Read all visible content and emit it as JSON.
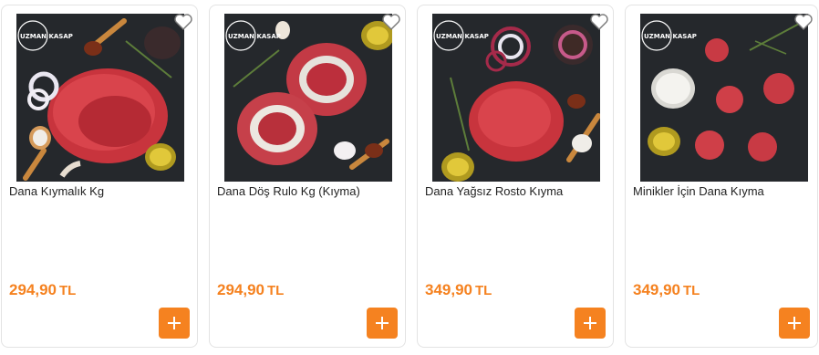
{
  "colors": {
    "accent": "#f58220",
    "image_bg": "#23262a"
  },
  "icons": {
    "favorite": "heart-icon",
    "add": "plus-icon"
  },
  "products": [
    {
      "title": "Dana Kıymalık Kg",
      "price": "294,90",
      "currency": "TL",
      "logo": "UZMAN KASAP"
    },
    {
      "title": "Dana Döş Rulo Kg (Kıyma)",
      "price": "294,90",
      "currency": "TL",
      "logo": "UZMAN KASAP"
    },
    {
      "title": "Dana Yağsız Rosto Kıyma",
      "price": "349,90",
      "currency": "TL",
      "logo": "UZMAN KASAP"
    },
    {
      "title": "Minikler İçin Dana Kıyma",
      "price": "349,90",
      "currency": "TL",
      "logo": "UZMAN KASAP"
    }
  ]
}
